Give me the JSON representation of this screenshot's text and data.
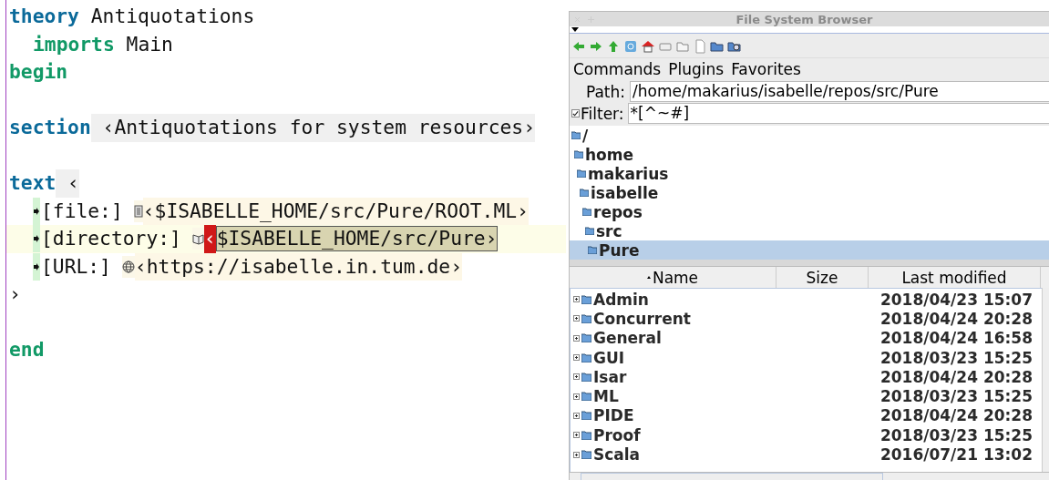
{
  "editor": {
    "lines": [
      {
        "kind": "code",
        "indented": false,
        "current": false,
        "segments": [
          {
            "kind": "command",
            "text": "theory"
          },
          {
            "kind": "plain",
            "text": " Antiquotations"
          }
        ]
      },
      {
        "kind": "code",
        "indented": true,
        "current": false,
        "segments": [
          {
            "kind": "keyword",
            "text": "imports"
          },
          {
            "kind": "plain",
            "text": " Main"
          }
        ]
      },
      {
        "kind": "code",
        "indented": false,
        "current": false,
        "segments": [
          {
            "kind": "keyword",
            "text": "begin"
          }
        ]
      },
      {
        "kind": "blank"
      },
      {
        "kind": "code",
        "indented": false,
        "current": false,
        "segments": [
          {
            "kind": "command",
            "text": "section"
          },
          {
            "kind": "cartouche",
            "text": " ‹Antiquotations for system resources›"
          }
        ]
      },
      {
        "kind": "blank"
      },
      {
        "kind": "code",
        "indented": false,
        "current": false,
        "segments": [
          {
            "kind": "command",
            "text": "text"
          },
          {
            "kind": "cartouche",
            "text": " ‹"
          }
        ]
      },
      {
        "kind": "code",
        "indented": true,
        "current": false,
        "segments": [
          {
            "kind": "file_antiquote",
            "label": "[file:]",
            "active": false,
            "text": "‹$ISABELLE_HOME/src/Pure/ROOT.ML›"
          }
        ]
      },
      {
        "kind": "code",
        "indented": true,
        "current": true,
        "segments": [
          {
            "kind": "directory_antiquote",
            "label": "[directory:]",
            "active": true,
            "bracket": "‹",
            "text": "$ISABELLE_HOME/src/Pure›"
          }
        ]
      },
      {
        "kind": "code",
        "indented": true,
        "current": false,
        "segments": [
          {
            "kind": "url_antiquote",
            "label": "[URL:]",
            "active": false,
            "text": "‹https://isabelle.in.tum.de›"
          }
        ]
      },
      {
        "kind": "code",
        "indented": false,
        "current": false,
        "segments": [
          {
            "kind": "plain",
            "text": "›"
          }
        ]
      },
      {
        "kind": "blank"
      },
      {
        "kind": "code",
        "indented": false,
        "current": false,
        "segments": [
          {
            "kind": "keyword",
            "text": "end"
          }
        ]
      }
    ]
  },
  "browser": {
    "title": "File System Browser",
    "menu": [
      "Commands",
      "Plugins",
      "Favorites"
    ],
    "path": {
      "label": "Path:",
      "value": "/home/makarius/isabelle/repos/src/Pure"
    },
    "filter": {
      "label": "Filter:",
      "checked": true,
      "value": "*[^~#]"
    },
    "tree": [
      {
        "name": "/",
        "selected": false,
        "children": [
          {
            "name": "home",
            "selected": false,
            "children": [
              {
                "name": "makarius",
                "selected": false,
                "children": [
                  {
                    "name": "isabelle",
                    "selected": false,
                    "children": [
                      {
                        "name": "repos",
                        "selected": false,
                        "children": [
                          {
                            "name": "src",
                            "selected": false,
                            "children": [
                              {
                                "name": "Pure",
                                "selected": true
                              }
                            ]
                          }
                        ]
                      }
                    ]
                  }
                ]
              }
            ]
          }
        ]
      }
    ],
    "table": {
      "columns": [
        "Name",
        "Size",
        "Last modified"
      ],
      "rows": [
        {
          "name": "Admin",
          "modified": "2018/04/23 15:07"
        },
        {
          "name": "Concurrent",
          "modified": "2018/04/24 20:28"
        },
        {
          "name": "General",
          "modified": "2018/04/24 16:58"
        },
        {
          "name": "GUI",
          "modified": "2018/03/23 15:25"
        },
        {
          "name": "Isar",
          "modified": "2018/04/24 20:28"
        },
        {
          "name": "ML",
          "modified": "2018/03/23 15:25"
        },
        {
          "name": "PIDE",
          "modified": "2018/04/24 20:28"
        },
        {
          "name": "Proof",
          "modified": "2018/03/23 15:25"
        },
        {
          "name": "Scala",
          "modified": "2016/07/21 13:02"
        }
      ]
    }
  }
}
